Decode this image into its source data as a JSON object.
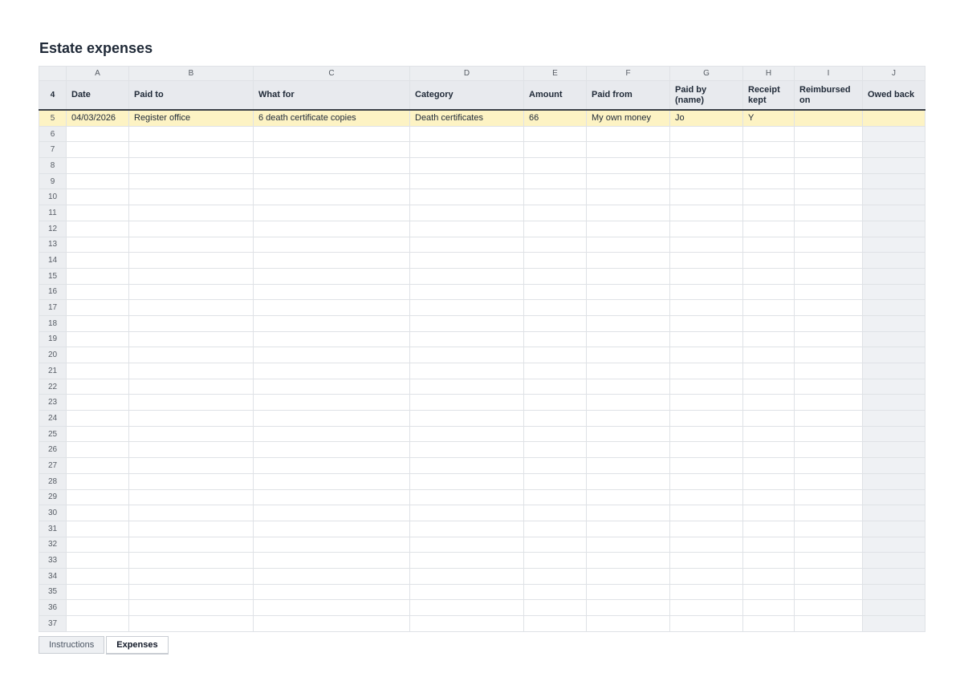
{
  "title": "Estate expenses",
  "column_letters": [
    "A",
    "B",
    "C",
    "D",
    "E",
    "F",
    "G",
    "H",
    "I",
    "J"
  ],
  "header_row_number": "4",
  "headers": [
    "Date",
    "Paid to",
    "What for",
    "Category",
    "Amount",
    "Paid from",
    "Paid by (name)",
    "Receipt kept",
    "Reimbursed on",
    "Owed back"
  ],
  "rows": [
    {
      "num": "5",
      "cells": [
        "04/03/2026",
        "Register office",
        "6 death certificate copies",
        "Death certificates",
        "66",
        "My own money",
        "Jo",
        "Y",
        "",
        ""
      ]
    },
    {
      "num": "6",
      "cells": [
        "",
        "",
        "",
        "",
        "",
        "",
        "",
        "",
        "",
        ""
      ]
    },
    {
      "num": "7",
      "cells": [
        "",
        "",
        "",
        "",
        "",
        "",
        "",
        "",
        "",
        ""
      ]
    },
    {
      "num": "8",
      "cells": [
        "",
        "",
        "",
        "",
        "",
        "",
        "",
        "",
        "",
        ""
      ]
    },
    {
      "num": "9",
      "cells": [
        "",
        "",
        "",
        "",
        "",
        "",
        "",
        "",
        "",
        ""
      ]
    },
    {
      "num": "10",
      "cells": [
        "",
        "",
        "",
        "",
        "",
        "",
        "",
        "",
        "",
        ""
      ]
    },
    {
      "num": "11",
      "cells": [
        "",
        "",
        "",
        "",
        "",
        "",
        "",
        "",
        "",
        ""
      ]
    },
    {
      "num": "12",
      "cells": [
        "",
        "",
        "",
        "",
        "",
        "",
        "",
        "",
        "",
        ""
      ]
    },
    {
      "num": "13",
      "cells": [
        "",
        "",
        "",
        "",
        "",
        "",
        "",
        "",
        "",
        ""
      ]
    },
    {
      "num": "14",
      "cells": [
        "",
        "",
        "",
        "",
        "",
        "",
        "",
        "",
        "",
        ""
      ]
    },
    {
      "num": "15",
      "cells": [
        "",
        "",
        "",
        "",
        "",
        "",
        "",
        "",
        "",
        ""
      ]
    },
    {
      "num": "16",
      "cells": [
        "",
        "",
        "",
        "",
        "",
        "",
        "",
        "",
        "",
        ""
      ]
    },
    {
      "num": "17",
      "cells": [
        "",
        "",
        "",
        "",
        "",
        "",
        "",
        "",
        "",
        ""
      ]
    },
    {
      "num": "18",
      "cells": [
        "",
        "",
        "",
        "",
        "",
        "",
        "",
        "",
        "",
        ""
      ]
    },
    {
      "num": "19",
      "cells": [
        "",
        "",
        "",
        "",
        "",
        "",
        "",
        "",
        "",
        ""
      ]
    },
    {
      "num": "20",
      "cells": [
        "",
        "",
        "",
        "",
        "",
        "",
        "",
        "",
        "",
        ""
      ]
    },
    {
      "num": "21",
      "cells": [
        "",
        "",
        "",
        "",
        "",
        "",
        "",
        "",
        "",
        ""
      ]
    },
    {
      "num": "22",
      "cells": [
        "",
        "",
        "",
        "",
        "",
        "",
        "",
        "",
        "",
        ""
      ]
    },
    {
      "num": "23",
      "cells": [
        "",
        "",
        "",
        "",
        "",
        "",
        "",
        "",
        "",
        ""
      ]
    },
    {
      "num": "24",
      "cells": [
        "",
        "",
        "",
        "",
        "",
        "",
        "",
        "",
        "",
        ""
      ]
    },
    {
      "num": "25",
      "cells": [
        "",
        "",
        "",
        "",
        "",
        "",
        "",
        "",
        "",
        ""
      ]
    },
    {
      "num": "26",
      "cells": [
        "",
        "",
        "",
        "",
        "",
        "",
        "",
        "",
        "",
        ""
      ]
    },
    {
      "num": "27",
      "cells": [
        "",
        "",
        "",
        "",
        "",
        "",
        "",
        "",
        "",
        ""
      ]
    },
    {
      "num": "28",
      "cells": [
        "",
        "",
        "",
        "",
        "",
        "",
        "",
        "",
        "",
        ""
      ]
    },
    {
      "num": "29",
      "cells": [
        "",
        "",
        "",
        "",
        "",
        "",
        "",
        "",
        "",
        ""
      ]
    },
    {
      "num": "30",
      "cells": [
        "",
        "",
        "",
        "",
        "",
        "",
        "",
        "",
        "",
        ""
      ]
    },
    {
      "num": "31",
      "cells": [
        "",
        "",
        "",
        "",
        "",
        "",
        "",
        "",
        "",
        ""
      ]
    },
    {
      "num": "32",
      "cells": [
        "",
        "",
        "",
        "",
        "",
        "",
        "",
        "",
        "",
        ""
      ]
    },
    {
      "num": "33",
      "cells": [
        "",
        "",
        "",
        "",
        "",
        "",
        "",
        "",
        "",
        ""
      ]
    },
    {
      "num": "34",
      "cells": [
        "",
        "",
        "",
        "",
        "",
        "",
        "",
        "",
        "",
        ""
      ]
    },
    {
      "num": "35",
      "cells": [
        "",
        "",
        "",
        "",
        "",
        "",
        "",
        "",
        "",
        ""
      ]
    },
    {
      "num": "36",
      "cells": [
        "",
        "",
        "",
        "",
        "",
        "",
        "",
        "",
        "",
        ""
      ]
    },
    {
      "num": "37",
      "cells": [
        "",
        "",
        "",
        "",
        "",
        "",
        "",
        "",
        "",
        ""
      ]
    }
  ],
  "tabs": [
    {
      "label": "Instructions",
      "active": false
    },
    {
      "label": "Expenses",
      "active": true
    }
  ],
  "colors": {
    "highlight_row": "#fdf3c4",
    "header_bg": "#e8eaee",
    "owed_back_col": "#eff1f4"
  }
}
